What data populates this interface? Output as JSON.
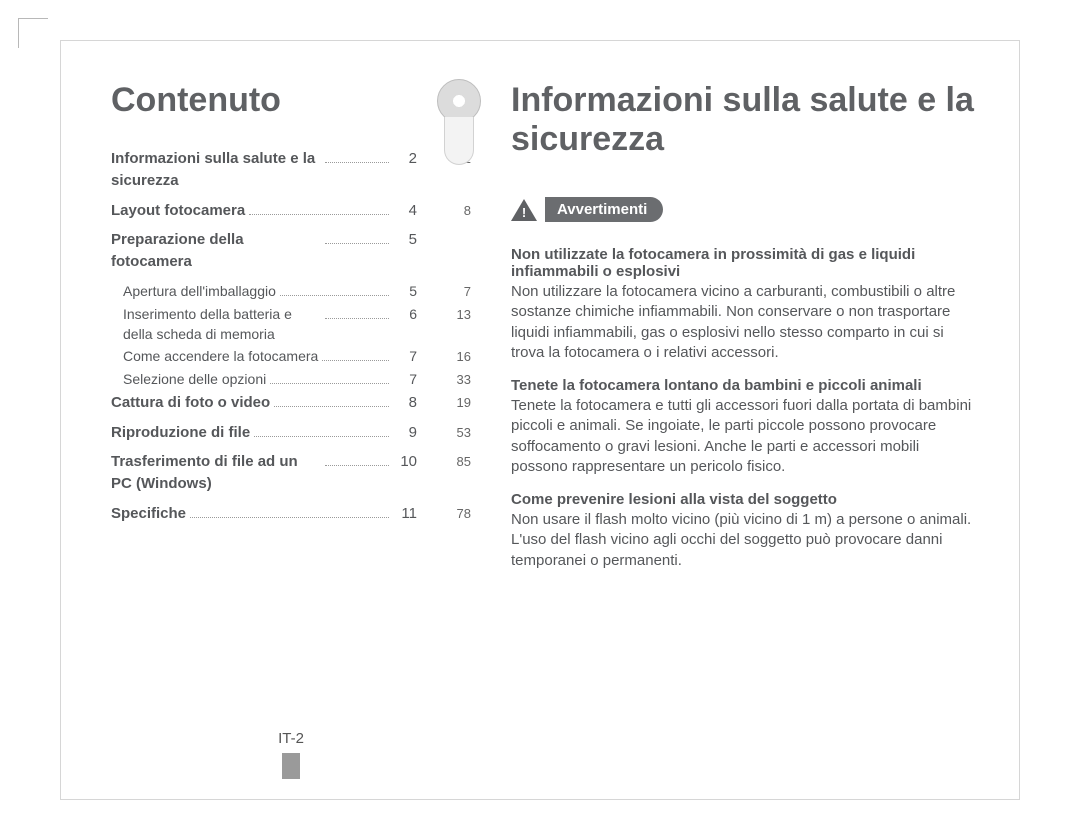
{
  "page_number_label": "IT-2",
  "left": {
    "title": "Contenuto",
    "toc": [
      {
        "type": "main",
        "label": "Informazioni sulla salute e la sicurezza",
        "page": "2",
        "extra": "1"
      },
      {
        "type": "main",
        "label": "Layout fotocamera",
        "page": "4",
        "extra": "8"
      },
      {
        "type": "main",
        "label": "Preparazione della fotocamera",
        "page": "5",
        "extra": ""
      },
      {
        "type": "sub",
        "label": "Apertura dell'imballaggio",
        "page": "5",
        "extra": "7"
      },
      {
        "type": "sub",
        "label": "Inserimento della batteria e della scheda di memoria",
        "page": "6",
        "extra": "13"
      },
      {
        "type": "sub",
        "label": "Come accendere la fotocamera",
        "page": "7",
        "extra": "16"
      },
      {
        "type": "sub",
        "label": "Selezione delle opzioni",
        "page": "7",
        "extra": "33"
      },
      {
        "type": "main",
        "label": "Cattura di foto o video",
        "page": "8",
        "extra": "19"
      },
      {
        "type": "main",
        "label": "Riproduzione di file",
        "page": "9",
        "extra": "53"
      },
      {
        "type": "main",
        "label": "Trasferimento di file ad un PC (Windows)",
        "page": "10",
        "extra": "85"
      },
      {
        "type": "main",
        "label": "Specifiche",
        "page": "11",
        "extra": "78"
      }
    ]
  },
  "right": {
    "title": "Informazioni sulla salute e la sicurezza",
    "warn_label": "Avvertimenti",
    "blocks": [
      {
        "heading": "Non utilizzate la fotocamera in prossimità di gas e liquidi infiammabili o esplosivi",
        "body": "Non utilizzare la fotocamera vicino a carburanti, combustibili o altre sostanze chimiche infiammabili. Non conservare o non trasportare liquidi infiammabili, gas o esplosivi nello stesso comparto in cui si trova la fotocamera o i relativi accessori."
      },
      {
        "heading": "Tenete la fotocamera lontano da bambini e piccoli animali",
        "body": "Tenete la fotocamera e tutti gli accessori fuori dalla portata di bambini piccoli e animali. Se ingoiate, le parti piccole possono provocare soffocamento o gravi lesioni. Anche le parti e accessori mobili possono rappresentare un pericolo fisico."
      },
      {
        "heading": "Come prevenire lesioni alla vista del soggetto",
        "body": "Non usare il flash molto vicino (più vicino di 1 m) a persone o animali. L'uso del flash vicino agli occhi del soggetto può provocare danni temporanei o permanenti."
      }
    ]
  }
}
